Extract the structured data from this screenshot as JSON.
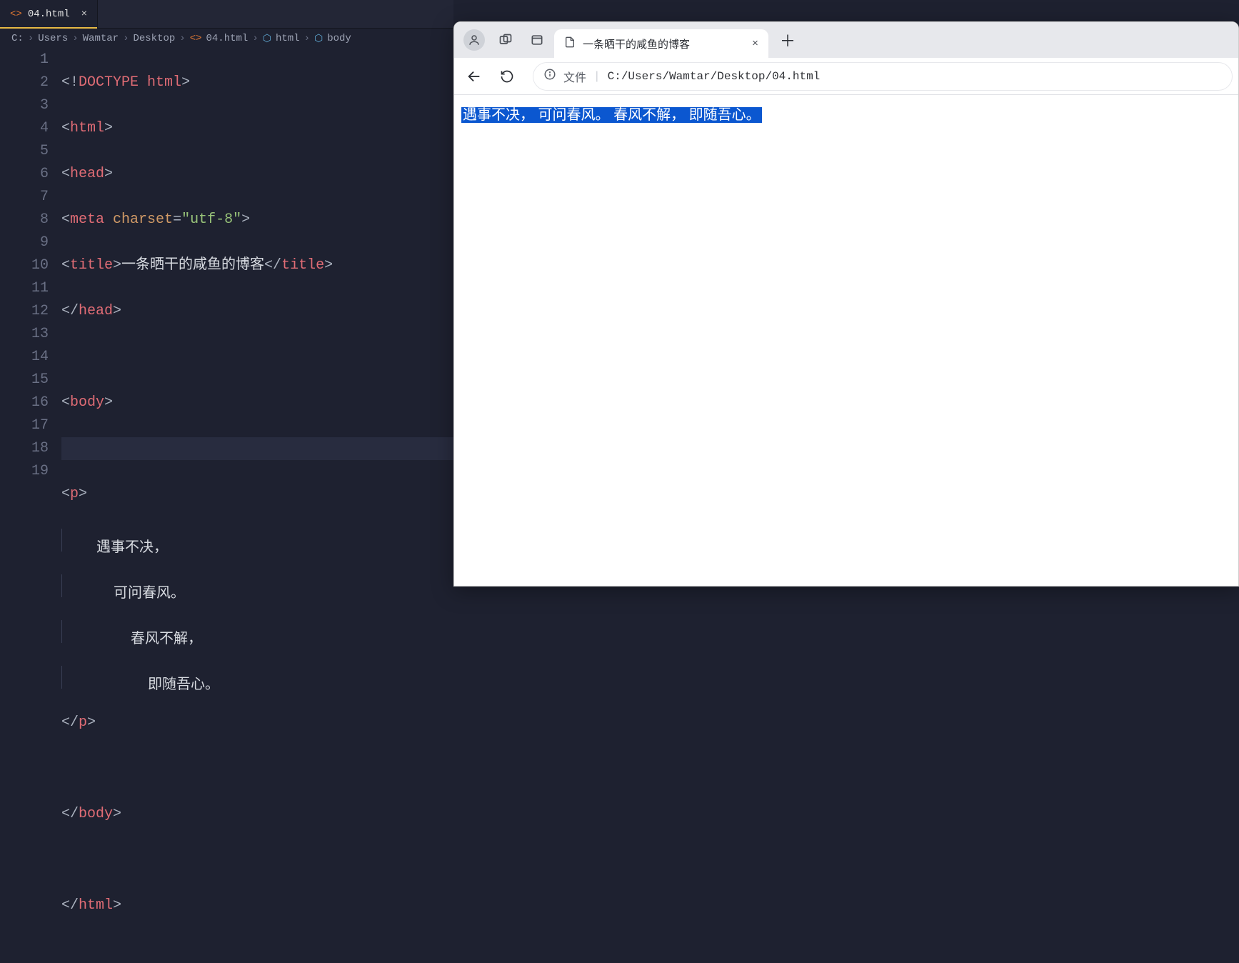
{
  "editor": {
    "tab": {
      "icon": "<>",
      "filename": "04.html",
      "close": "×"
    },
    "breadcrumbs": [
      "C:",
      "Users",
      "Wamtar",
      "Desktop",
      "04.html",
      "html",
      "body"
    ],
    "code": {
      "lines": 19,
      "l1_doctype": "DOCTYPE",
      "l1_html": "html",
      "l2_html": "html",
      "l3_head": "head",
      "l4_meta": "meta",
      "l4_attr": "charset",
      "l4_val": "\"utf-8\"",
      "l5_title": "title",
      "l5_text": "一条晒干的咸鱼的博客",
      "l6_head": "head",
      "l8_body": "body",
      "l10_p": "p",
      "l11_text": "遇事不决，",
      "l12_text": "可问春风。",
      "l13_text": "春风不解，",
      "l14_text": "即随吾心。",
      "l15_p": "p",
      "l17_body": "body",
      "l19_html": "html"
    }
  },
  "browser": {
    "tab_title": "一条晒干的咸鱼的博客",
    "new_tab": "＋",
    "close": "×",
    "back": "←",
    "refresh": "⟳",
    "info": "ⓘ",
    "scheme_label": "文件",
    "pipe": "|",
    "url": "C:/Users/Wamtar/Desktop/04.html",
    "page_text": "遇事不决， 可问春风。 春风不解， 即随吾心。"
  }
}
